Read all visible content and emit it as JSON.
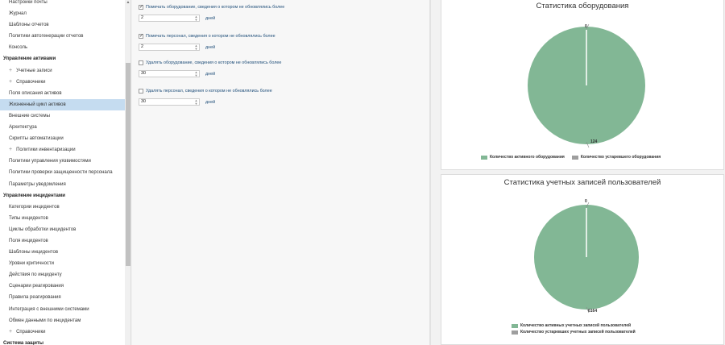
{
  "sidebar": {
    "items": [
      {
        "label": "Настройки почты",
        "kind": "item"
      },
      {
        "label": "Журнал",
        "kind": "item"
      },
      {
        "label": "Шаблоны отчетов",
        "kind": "item"
      },
      {
        "label": "Политики автогенерации отчетов",
        "kind": "item"
      },
      {
        "label": "Консоль",
        "kind": "item"
      },
      {
        "label": "Управление активами",
        "kind": "section"
      },
      {
        "label": "Учетные записи",
        "kind": "sub"
      },
      {
        "label": "Справочники",
        "kind": "sub"
      },
      {
        "label": "Поля описания активов",
        "kind": "item"
      },
      {
        "label": "Жизненный цикл активов",
        "kind": "item",
        "active": true
      },
      {
        "label": "Внешние системы",
        "kind": "item"
      },
      {
        "label": "Архитектура",
        "kind": "item"
      },
      {
        "label": "Скрипты автоматизации",
        "kind": "item"
      },
      {
        "label": "Политики инвентаризации",
        "kind": "sub"
      },
      {
        "label": "Политики управления уязвимостями",
        "kind": "item"
      },
      {
        "label": "Политики проверки защищенности персонала",
        "kind": "item"
      },
      {
        "label": "Параметры уведомления",
        "kind": "item"
      },
      {
        "label": "Управление инцидентами",
        "kind": "section"
      },
      {
        "label": "Категории инцидентов",
        "kind": "item"
      },
      {
        "label": "Типы инцидентов",
        "kind": "item"
      },
      {
        "label": "Циклы обработки инцидентов",
        "kind": "item"
      },
      {
        "label": "Поля инцидентов",
        "kind": "item"
      },
      {
        "label": "Шаблоны инцидентов",
        "kind": "item"
      },
      {
        "label": "Уровни критичности",
        "kind": "item"
      },
      {
        "label": "Действия по инциденту",
        "kind": "item"
      },
      {
        "label": "Сценарии реагирования",
        "kind": "item"
      },
      {
        "label": "Правила реагирования",
        "kind": "item"
      },
      {
        "label": "Интеграция с внешними системами",
        "kind": "item"
      },
      {
        "label": "Обмен данными по инцидентам",
        "kind": "item"
      },
      {
        "label": "Справочники",
        "kind": "sub"
      },
      {
        "label": "Система защиты",
        "kind": "section"
      }
    ],
    "plus_glyph": "+"
  },
  "form": {
    "groups": [
      {
        "checkbox_label": "Помечать оборудование, сведения о котором не обновлялись более",
        "checked": true,
        "value": "2",
        "unit": "дней"
      },
      {
        "checkbox_label": "Помечать персонал, сведения о котором не обновлялись более",
        "checked": true,
        "value": "2",
        "unit": "дней"
      },
      {
        "checkbox_label": "Удалять оборудование, сведения о котором не обновлялись более",
        "checked": false,
        "value": "30",
        "unit": "дней"
      },
      {
        "checkbox_label": "Удалять персонал, сведения о котором не обновлялись более",
        "checked": false,
        "value": "30",
        "unit": "дней"
      }
    ]
  },
  "colors": {
    "active": "#82b795",
    "outdated": "#9e9e9e",
    "selected_row": "#c5dcf0",
    "link_text": "#1f4e79"
  },
  "chart_data": [
    {
      "type": "pie",
      "title": "Статистика оборудования",
      "categories": [
        "Количество активного оборудования",
        "Количество устаревшего оборудования"
      ],
      "values": [
        124,
        0
      ],
      "value_labels": [
        "124",
        "0"
      ],
      "legend_placement": "bottom"
    },
    {
      "type": "pie",
      "title": "Статистика учетных записей пользователей",
      "categories": [
        "Количество активных учетных записей пользователей",
        "Количество устаревших учетных записей пользователей"
      ],
      "values": [
        6164,
        0
      ],
      "value_labels": [
        "6164",
        "0"
      ],
      "legend_placement": "bottom"
    }
  ]
}
